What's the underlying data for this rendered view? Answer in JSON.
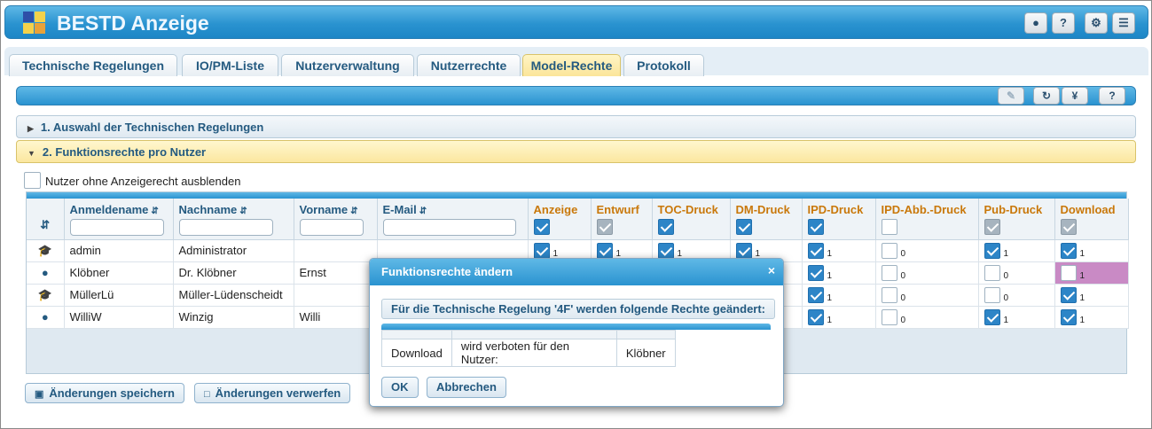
{
  "app": {
    "title": "BESTD Anzeige",
    "header_icons": [
      "user-icon",
      "help-icon",
      "gear-icon",
      "menu-icon"
    ]
  },
  "tabs": [
    {
      "label": "Technische Regelungen",
      "active": false
    },
    {
      "label": "IO/PM-Liste",
      "active": false
    },
    {
      "label": "Nutzerverwaltung",
      "active": false
    },
    {
      "label": "Nutzerrechte",
      "active": false
    },
    {
      "label": "Model-Rechte",
      "active": true
    },
    {
      "label": "Protokoll",
      "active": false
    }
  ],
  "toolbar": {
    "buttons": [
      {
        "icon": "edit-icon",
        "enabled": false
      },
      {
        "icon": "refresh-icon",
        "enabled": true
      },
      {
        "icon": "yen-icon",
        "label": "¥",
        "enabled": true
      },
      {
        "icon": "help-icon",
        "label": "?",
        "enabled": true
      }
    ]
  },
  "accordion": {
    "section1": "1. Auswahl der Technischen Regelungen",
    "section2": "2. Funktionsrechte pro Nutzer"
  },
  "hide_users_checkbox": {
    "label": "Nutzer ohne Anzeigerecht ausblenden",
    "checked": false
  },
  "grid": {
    "columns": {
      "anmeldename": "Anmeldename",
      "nachname": "Nachname",
      "vorname": "Vorname",
      "email": "E-Mail",
      "anzeige": "Anzeige",
      "entwurf": "Entwurf",
      "toc": "TOC-Druck",
      "dm": "DM-Druck",
      "ipd": "IPD-Druck",
      "ipdabb": "IPD-Abb.-Druck",
      "pub": "Pub-Druck",
      "download": "Download"
    },
    "header_checks": {
      "anzeige": "on",
      "entwurf": "grey",
      "toc": "on",
      "dm": "on",
      "ipd": "on",
      "ipdabb": "off",
      "pub": "grey",
      "download": "grey"
    },
    "rows": [
      {
        "icon": "graduation-cap-icon",
        "anmeldename": "admin",
        "nachname": "Administrator",
        "vorname": "",
        "email": "",
        "rights": {
          "anzeige": "1",
          "entwurf": "1",
          "toc": "1",
          "dm": "1",
          "ipd": "1",
          "ipdabb": "0",
          "pub": "1",
          "download": "1"
        },
        "checks": {
          "anzeige": true,
          "entwurf": true,
          "toc": true,
          "dm": true,
          "ipd": true,
          "ipdabb": false,
          "pub": true,
          "download": true
        }
      },
      {
        "icon": "user-icon",
        "anmeldename": "Klöbner",
        "nachname": "Dr. Klöbner",
        "vorname": "Ernst",
        "email": "",
        "rights": {
          "anzeige": "",
          "entwurf": "",
          "toc": "",
          "dm": "",
          "ipd": "1",
          "ipdabb": "0",
          "pub": "0",
          "download": "1"
        },
        "checks": {
          "ipd": true,
          "ipdabb": false,
          "pub": false,
          "download": false
        }
      },
      {
        "icon": "graduation-cap-icon",
        "anmeldename": "MüllerLü",
        "nachname": "Müller-Lüdenscheidt",
        "vorname": "",
        "email": "",
        "rights": {
          "anzeige": "",
          "entwurf": "",
          "toc": "",
          "dm": "",
          "ipd": "1",
          "ipdabb": "0",
          "pub": "0",
          "download": "1"
        },
        "checks": {
          "ipd": true,
          "ipdabb": false,
          "pub": false,
          "download": true
        }
      },
      {
        "icon": "user-icon",
        "anmeldename": "WilliW",
        "nachname": "Winzig",
        "vorname": "Willi",
        "email": "",
        "rights": {
          "anzeige": "",
          "entwurf": "",
          "toc": "",
          "dm": "",
          "ipd": "1",
          "ipdabb": "0",
          "pub": "1",
          "download": "1"
        },
        "checks": {
          "ipd": true,
          "ipdabb": false,
          "pub": true,
          "download": true
        }
      }
    ]
  },
  "buttons": {
    "save": "Änderungen speichern",
    "discard": "Änderungen verwerfen"
  },
  "dialog": {
    "title": "Funktionsrechte ändern",
    "close": "×",
    "message": "Für die Technische Regelung '4F' werden folgende Rechte geändert:",
    "row": {
      "right": "Download",
      "action": "wird verboten für den Nutzer:",
      "user": "Klöbner"
    },
    "ok": "OK",
    "cancel": "Abbrechen"
  },
  "colors": {
    "accent_blue": "#2a93d0",
    "active_tab": "#fbe59a",
    "rights_header": "#c9780a",
    "changed_cell": "#c98ac5"
  }
}
